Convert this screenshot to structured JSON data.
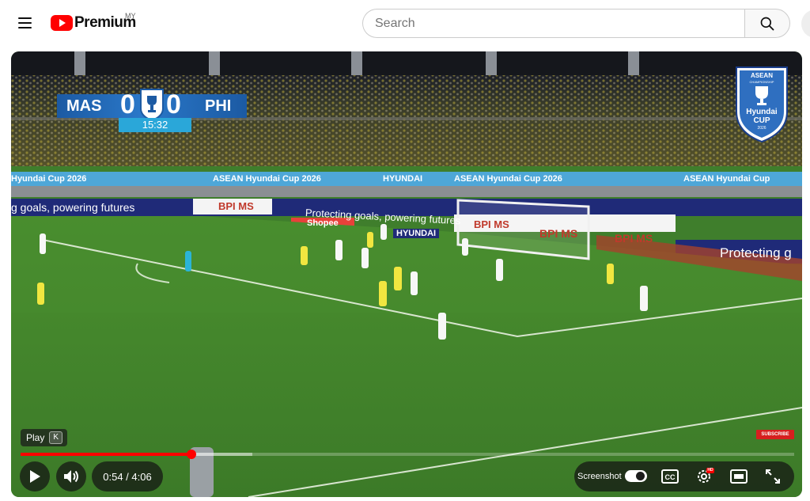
{
  "header": {
    "logo_text": "Premium",
    "country_code": "MY",
    "search_placeholder": "Search"
  },
  "player": {
    "scoreboard": {
      "home_team": "MAS",
      "home_score": "0",
      "away_score": "0",
      "away_team": "PHI",
      "clock": "15:32"
    },
    "cup_logo": {
      "top_text": "ASEAN",
      "sub_text": "CHAMPIONSHIP",
      "name_line1": "Hyundai",
      "name_line2": "CUP",
      "year": "2026"
    },
    "boards": {
      "upper": [
        "Hyundai Cup 2026",
        "ASEAN Hyundai Cup 2026",
        "HYUNDAI",
        "ASEAN Hyundai Cup 2026",
        "ASEAN Hyundai Cup"
      ],
      "slogan": "Protecting goals, powering futures",
      "slogan_left": "g goals, powering futures",
      "slogan_right": "Protecting g",
      "sponsor1": "BPI MS",
      "sponsor2": "Shopee",
      "sponsor3": "HYUNDAI"
    },
    "tooltip": {
      "label": "Play",
      "key": "K"
    },
    "subscribe_watermark": "SUBSCRIBE",
    "progress": {
      "played_fraction": 0.221,
      "buffered_fraction": 0.3
    },
    "time_display": "0:54 / 4:06",
    "screenshot_label": "Screenshot",
    "hd_badge": "HD",
    "colors": {
      "progress_red": "#ff0000",
      "brand_red": "#ff0000",
      "scoreboard_blue": "#1c5aa3",
      "clock_cyan": "#2aa7d9",
      "pitch_green": "#3f7e2c"
    },
    "icons": [
      "play-icon",
      "volume-icon",
      "screenshot-toggle",
      "cc-icon",
      "settings-icon",
      "theater-icon",
      "fullscreen-icon"
    ]
  }
}
